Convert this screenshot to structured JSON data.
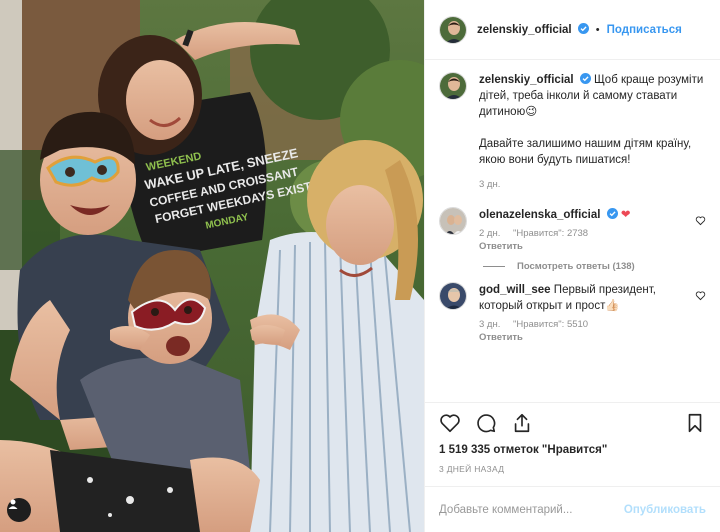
{
  "post": {
    "author": "zelenskiy_official",
    "follow_label": "Подписаться",
    "dot": "•",
    "caption_line1": "Щоб краще розуміти дітей, треба інколи й самому ставати дитиною😉",
    "caption_line2": "Давайте залишимо нашим дітям країну, якою вони будуть пишатися!",
    "caption_time": "3 дн."
  },
  "comments": [
    {
      "user": "olenazelenska_official",
      "text": "❤",
      "time": "2 дн.",
      "likes": "\"Нравится\": 2738",
      "reply": "Ответить"
    },
    {
      "user": "god_will_see",
      "text": "Первый президент, который открыт и прост👍🏻",
      "time": "3 дн.",
      "likes": "\"Нравится\": 5510",
      "reply": "Ответить"
    }
  ],
  "view_replies": "Посмотреть ответы (138)",
  "likes_line": "1 519 335 отметок \"Нравится\"",
  "date_line": "3 ДНЕЙ НАЗАД",
  "comment_input": {
    "placeholder": "Добавьте комментарий...",
    "publish": "Опубликовать"
  },
  "icons": {
    "like": "heart-icon",
    "comment": "comment-icon",
    "share": "share-icon",
    "save": "bookmark-icon",
    "tag": "user-tag-icon",
    "verified": "verified-badge-icon"
  },
  "colors": {
    "link": "#3897f0",
    "muted": "#8e8e8e",
    "heart_red": "#ed4956",
    "publish_disabled": "#b2dffc"
  },
  "photo_shirt_text": [
    "WEEKEND",
    "WAKE UP LATE, SNEEZE",
    "COFFEE AND CROISSANT",
    "FORGET WEEKDAYS EXIST",
    "MONDAY"
  ]
}
